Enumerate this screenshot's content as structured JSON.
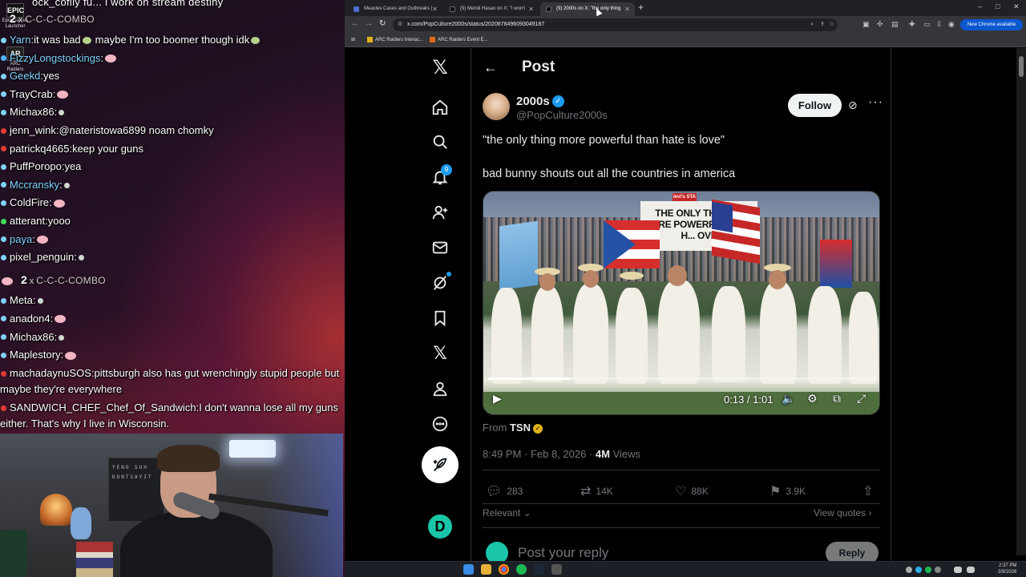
{
  "desktop": {
    "icons": [
      {
        "label": "Epic Games Launcher",
        "glyph": "EPIC"
      },
      {
        "label": "ARC Raiders",
        "glyph": "AR"
      }
    ]
  },
  "chat": {
    "top_partial": {
      "count": "2",
      "x": "x",
      "text": "C-C-C-COMBO",
      "cutoff": "ock_coflly fu... i work on stream destiny"
    },
    "messages": [
      {
        "user": "Yarn",
        "text": "it was bad",
        "after": "maybe I'm too boomer though idk",
        "color": "#7fd3ff",
        "dot": "#7fd3ff"
      },
      {
        "user": "FizzyLongstockings",
        "text": "",
        "color": "#7fd3ff",
        "dot": "#4fb3ff"
      },
      {
        "user": "Geekd",
        "text": "yes",
        "color": "#7fd3ff",
        "dot": "#7fd3ff"
      },
      {
        "user": "TrayCrab",
        "text": "",
        "color": "#ffffff",
        "dot": "#7fd3ff"
      },
      {
        "user": "Michax86",
        "text": "",
        "color": "#ffffff",
        "dot": "#7fd3ff"
      },
      {
        "user": "jenn_wink",
        "text": "@nateristowa6899 noam chomky",
        "color": "#ffffff",
        "dot": "#e53935"
      },
      {
        "user": "patrickq4665",
        "text": "keep your guns",
        "color": "#ffffff",
        "dot": "#e53935"
      },
      {
        "user": "PuffPoropo",
        "text": "yea",
        "color": "#ffffff",
        "dot": "#7fd3ff"
      },
      {
        "user": "Mccransky",
        "text": "",
        "color": "#7fd3ff",
        "dot": "#7fd3ff"
      },
      {
        "user": "ColdFire",
        "text": "",
        "color": "#ffffff",
        "dot": "#7fd3ff"
      },
      {
        "user": "atterant",
        "text": "yooo",
        "color": "#ffffff",
        "dot": "#3ddc5a"
      },
      {
        "user": "paya",
        "text": "",
        "color": "#7fd3ff",
        "dot": "#7fd3ff"
      },
      {
        "user": "pixel_penguin",
        "text": "",
        "color": "#ffffff",
        "dot": "#7fd3ff"
      }
    ],
    "combo": {
      "count": "2",
      "x": "x",
      "text": "C-C-C-COMBO"
    },
    "messages2": [
      {
        "user": "Meta",
        "text": "",
        "color": "#ffffff",
        "dot": "#7fd3ff"
      },
      {
        "user": "anadon4",
        "text": "",
        "color": "#ffffff",
        "dot": "#7fd3ff"
      },
      {
        "user": "Michax86",
        "text": "",
        "color": "#ffffff",
        "dot": "#7fd3ff"
      },
      {
        "user": "Maplestory",
        "text": "",
        "color": "#ffffff",
        "dot": "#7fd3ff"
      },
      {
        "user": "machadaynuSOS",
        "text": "pittsburgh also has gut wrenchingly stupid people but maybe they're everywhere",
        "color": "#ffffff",
        "dot": "#e53935"
      },
      {
        "user": "SANDWICH_CHEF_Chef_Of_Sandwich",
        "text": "I don't wanna lose all my guns either. That's why I live in Wisconsin.",
        "color": "#ffffff",
        "dot": "#e53935"
      }
    ]
  },
  "webcam": {
    "wall_sign": "YENO SUH DONTSAYIT"
  },
  "browser": {
    "tabs": [
      {
        "title": "Measles Cases and Outbreaks |",
        "fav_color": "#4a6fd1"
      },
      {
        "title": "(9) Mehdi Hasan on X: \"I won't",
        "fav_color": "#111111"
      },
      {
        "title": "(9) 2000s on X: \"the only thing",
        "fav_color": "#111111"
      }
    ],
    "url": "x.com/PopCulture2000s/status/2020676496093049187",
    "update_label": "New Chrome available",
    "bookmarks": [
      "ARC Raiders Interac...",
      "ARC Raiders Event E..."
    ]
  },
  "post": {
    "header_title": "Post",
    "display_name": "2000s",
    "handle": "@PopCulture2000s",
    "follow_label": "Follow",
    "text1": "\"the only thing more powerful than hate is love\"",
    "text2": "bad bunny shouts out all the countries in america",
    "video": {
      "banner": "THE ONLY THING IS MORE POWERFUL THAN H... OVE",
      "banner_logo": "levi's STA",
      "time": "0:13 / 1:01",
      "progress": 0.213
    },
    "source_prefix": "From",
    "source": "TSN",
    "time": "8:49 PM · Feb 8, 2026 · ",
    "views_count": "4M",
    "views_label": "Views",
    "replies": "283",
    "reposts": "14K",
    "likes": "88K",
    "bookmarks": "3.9K",
    "relevant_label": "Relevant",
    "view_quotes_label": "View quotes",
    "reply_placeholder": "Post your reply",
    "reply_button": "Reply",
    "notification_count": "9"
  },
  "taskbar": {
    "time": "2:37 PM",
    "date": "2/9/2026"
  },
  "colors": {
    "accent": "#1d9bf0",
    "chrome_update": "#0b57d0",
    "bg": "#000000"
  }
}
